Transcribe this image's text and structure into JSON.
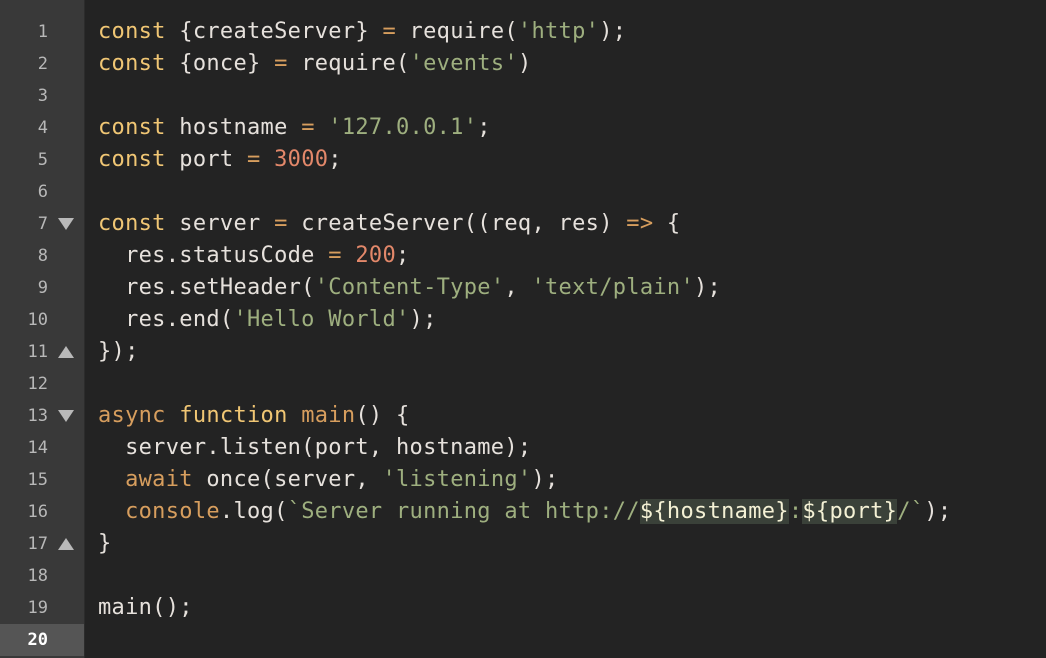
{
  "editor": {
    "active_line": 20,
    "colors": {
      "background": "#232323",
      "gutter": "#393939",
      "keyword": "#f0c674",
      "function": "#d79e5e",
      "text": "#e6e1dc",
      "string": "#9eaf7f",
      "number": "#e3886a"
    },
    "lines": [
      {
        "number": "1",
        "fold": "",
        "tokens": [
          {
            "t": "const",
            "c": "kw"
          },
          {
            "t": " {createServer} ",
            "c": "tx"
          },
          {
            "t": "=",
            "c": "op"
          },
          {
            "t": " require(",
            "c": "tx"
          },
          {
            "t": "'http'",
            "c": "st"
          },
          {
            "t": ");",
            "c": "tx"
          }
        ]
      },
      {
        "number": "2",
        "fold": "",
        "tokens": [
          {
            "t": "const",
            "c": "kw"
          },
          {
            "t": " {once} ",
            "c": "tx"
          },
          {
            "t": "=",
            "c": "op"
          },
          {
            "t": " require(",
            "c": "tx"
          },
          {
            "t": "'events'",
            "c": "st"
          },
          {
            "t": ")",
            "c": "tx"
          }
        ]
      },
      {
        "number": "3",
        "fold": "",
        "tokens": []
      },
      {
        "number": "4",
        "fold": "",
        "tokens": [
          {
            "t": "const",
            "c": "kw"
          },
          {
            "t": " hostname ",
            "c": "tx"
          },
          {
            "t": "=",
            "c": "op"
          },
          {
            "t": " ",
            "c": "tx"
          },
          {
            "t": "'127.0.0.1'",
            "c": "st"
          },
          {
            "t": ";",
            "c": "tx"
          }
        ]
      },
      {
        "number": "5",
        "fold": "",
        "tokens": [
          {
            "t": "const",
            "c": "kw"
          },
          {
            "t": " port ",
            "c": "tx"
          },
          {
            "t": "=",
            "c": "op"
          },
          {
            "t": " ",
            "c": "tx"
          },
          {
            "t": "3000",
            "c": "nm"
          },
          {
            "t": ";",
            "c": "tx"
          }
        ]
      },
      {
        "number": "6",
        "fold": "",
        "tokens": []
      },
      {
        "number": "7",
        "fold": "down",
        "tokens": [
          {
            "t": "const",
            "c": "kw"
          },
          {
            "t": " server ",
            "c": "tx"
          },
          {
            "t": "=",
            "c": "op"
          },
          {
            "t": " createServer((req, res) ",
            "c": "tx"
          },
          {
            "t": "=>",
            "c": "op"
          },
          {
            "t": " {",
            "c": "tx"
          }
        ]
      },
      {
        "number": "8",
        "fold": "",
        "tokens": [
          {
            "t": "  res.statusCode ",
            "c": "tx"
          },
          {
            "t": "=",
            "c": "op"
          },
          {
            "t": " ",
            "c": "tx"
          },
          {
            "t": "200",
            "c": "nm"
          },
          {
            "t": ";",
            "c": "tx"
          }
        ]
      },
      {
        "number": "9",
        "fold": "",
        "tokens": [
          {
            "t": "  res.setHeader(",
            "c": "tx"
          },
          {
            "t": "'Content-Type'",
            "c": "st"
          },
          {
            "t": ", ",
            "c": "tx"
          },
          {
            "t": "'text/plain'",
            "c": "st"
          },
          {
            "t": ");",
            "c": "tx"
          }
        ]
      },
      {
        "number": "10",
        "fold": "",
        "tokens": [
          {
            "t": "  res.end(",
            "c": "tx"
          },
          {
            "t": "'Hello World'",
            "c": "st"
          },
          {
            "t": ");",
            "c": "tx"
          }
        ]
      },
      {
        "number": "11",
        "fold": "up",
        "tokens": [
          {
            "t": "});",
            "c": "tx"
          }
        ]
      },
      {
        "number": "12",
        "fold": "",
        "tokens": []
      },
      {
        "number": "13",
        "fold": "down",
        "tokens": [
          {
            "t": "async",
            "c": "fn"
          },
          {
            "t": " ",
            "c": "tx"
          },
          {
            "t": "function",
            "c": "kw"
          },
          {
            "t": " ",
            "c": "tx"
          },
          {
            "t": "main",
            "c": "fn"
          },
          {
            "t": "() {",
            "c": "tx"
          }
        ]
      },
      {
        "number": "14",
        "fold": "",
        "tokens": [
          {
            "t": "  server.listen(port, hostname);",
            "c": "tx"
          }
        ]
      },
      {
        "number": "15",
        "fold": "",
        "tokens": [
          {
            "t": "  ",
            "c": "tx"
          },
          {
            "t": "await",
            "c": "fn"
          },
          {
            "t": " once(server, ",
            "c": "tx"
          },
          {
            "t": "'listening'",
            "c": "st"
          },
          {
            "t": ");",
            "c": "tx"
          }
        ]
      },
      {
        "number": "16",
        "fold": "",
        "tokens": [
          {
            "t": "  ",
            "c": "tx"
          },
          {
            "t": "console",
            "c": "ck"
          },
          {
            "t": ".log(",
            "c": "tx"
          },
          {
            "t": "`Server running at http://",
            "c": "st"
          },
          {
            "t": "${hostname}",
            "c": "hl"
          },
          {
            "t": ":",
            "c": "st"
          },
          {
            "t": "${port}",
            "c": "hl"
          },
          {
            "t": "/`",
            "c": "st"
          },
          {
            "t": ");",
            "c": "tx"
          }
        ]
      },
      {
        "number": "17",
        "fold": "up",
        "tokens": [
          {
            "t": "}",
            "c": "tx"
          }
        ]
      },
      {
        "number": "18",
        "fold": "",
        "tokens": []
      },
      {
        "number": "19",
        "fold": "",
        "tokens": [
          {
            "t": "main();",
            "c": "tx"
          }
        ]
      },
      {
        "number": "20",
        "fold": "",
        "tokens": []
      }
    ]
  }
}
